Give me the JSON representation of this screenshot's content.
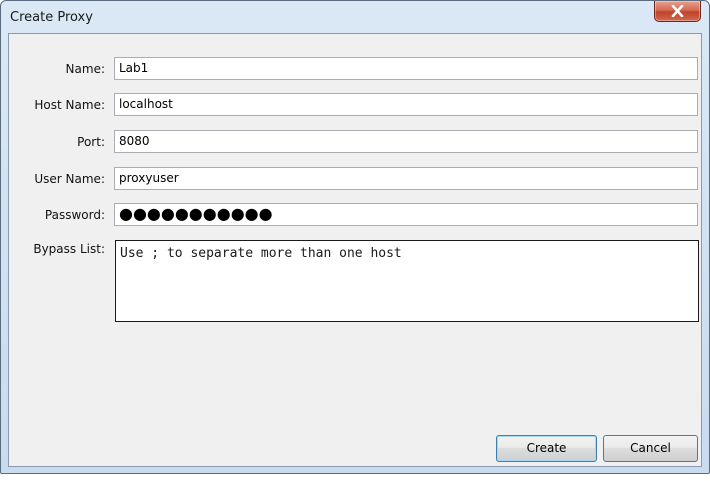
{
  "window": {
    "title": "Create Proxy"
  },
  "form": {
    "name_label": "Name:",
    "name_value": "Lab1",
    "host_label": "Host Name:",
    "host_value": "localhost",
    "port_label": "Port:",
    "port_value": "8080",
    "user_label": "User Name:",
    "user_value": "proxyuser",
    "password_label": "Password:",
    "password_masked": "●●●●●●●●●●●",
    "bypass_label": "Bypass List:",
    "bypass_value": "Use ; to separate more than one host"
  },
  "buttons": {
    "create_label": "Create",
    "cancel_label": "Cancel"
  },
  "icons": {
    "close": "close-icon"
  }
}
